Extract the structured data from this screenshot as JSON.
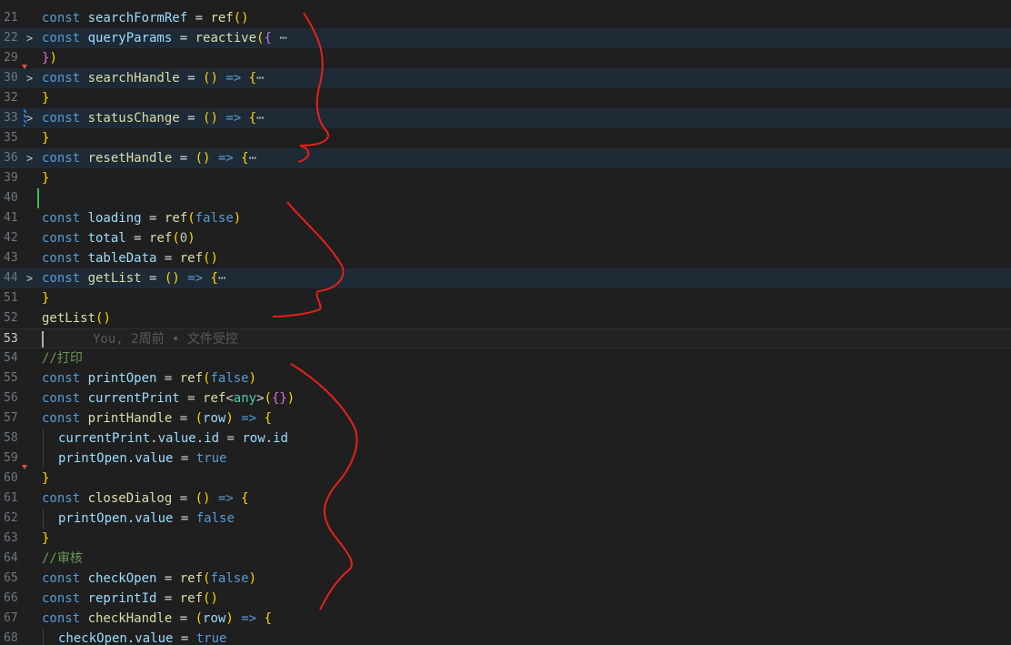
{
  "editor": {
    "blame_text": "You, 2周前 • 文件受控",
    "annotation_color": "#e8201a",
    "lines": [
      {
        "n": "21",
        "fold": "",
        "tokens": [
          [
            "kw",
            "const "
          ],
          [
            "var",
            "searchFormRef"
          ],
          [
            "op",
            " = "
          ],
          [
            "fn",
            "ref"
          ],
          [
            "b1",
            "()"
          ]
        ]
      },
      {
        "n": "22",
        "fold": ">",
        "folded": true,
        "tokens": [
          [
            "kw",
            "const "
          ],
          [
            "var",
            "queryParams"
          ],
          [
            "op",
            " = "
          ],
          [
            "fn",
            "reactive"
          ],
          [
            "b1",
            "("
          ],
          [
            "b2",
            "{"
          ],
          [
            "ell",
            " ⋯"
          ]
        ]
      },
      {
        "n": "29",
        "fold": "",
        "tokens": [
          [
            "b2",
            "}"
          ],
          [
            "b1",
            ")"
          ]
        ]
      },
      {
        "n": "30",
        "fold": ">",
        "folded": true,
        "tokens": [
          [
            "kw",
            "const "
          ],
          [
            "fn",
            "searchHandle"
          ],
          [
            "op",
            " = "
          ],
          [
            "b1",
            "()"
          ],
          [
            "kw",
            " => "
          ],
          [
            "b1",
            "{"
          ],
          [
            "ell",
            "⋯"
          ]
        ]
      },
      {
        "n": "32",
        "fold": "",
        "tokens": [
          [
            "b1",
            "}"
          ]
        ]
      },
      {
        "n": "33",
        "fold": ">",
        "folded": true,
        "tokens": [
          [
            "kw",
            "const "
          ],
          [
            "fn",
            "statusChange"
          ],
          [
            "op",
            " = "
          ],
          [
            "b1",
            "()"
          ],
          [
            "kw",
            " => "
          ],
          [
            "b1",
            "{"
          ],
          [
            "ell",
            "⋯"
          ]
        ]
      },
      {
        "n": "35",
        "fold": "",
        "tokens": [
          [
            "b1",
            "}"
          ]
        ]
      },
      {
        "n": "36",
        "fold": ">",
        "folded": true,
        "tokens": [
          [
            "kw",
            "const "
          ],
          [
            "fn",
            "resetHandle"
          ],
          [
            "op",
            " = "
          ],
          [
            "b1",
            "()"
          ],
          [
            "kw",
            " => "
          ],
          [
            "b1",
            "{"
          ],
          [
            "ell",
            "⋯"
          ]
        ]
      },
      {
        "n": "39",
        "fold": "",
        "tokens": [
          [
            "b1",
            "}"
          ]
        ]
      },
      {
        "n": "40",
        "fold": "",
        "tokens": []
      },
      {
        "n": "41",
        "fold": "",
        "tokens": [
          [
            "kw",
            "const "
          ],
          [
            "var",
            "loading"
          ],
          [
            "op",
            " = "
          ],
          [
            "fn",
            "ref"
          ],
          [
            "b1",
            "("
          ],
          [
            "kw",
            "false"
          ],
          [
            "b1",
            ")"
          ]
        ]
      },
      {
        "n": "42",
        "fold": "",
        "tokens": [
          [
            "kw",
            "const "
          ],
          [
            "var",
            "total"
          ],
          [
            "op",
            " = "
          ],
          [
            "fn",
            "ref"
          ],
          [
            "b1",
            "("
          ],
          [
            "num",
            "0"
          ],
          [
            "b1",
            ")"
          ]
        ]
      },
      {
        "n": "43",
        "fold": "",
        "tokens": [
          [
            "kw",
            "const "
          ],
          [
            "var",
            "tableData"
          ],
          [
            "op",
            " = "
          ],
          [
            "fn",
            "ref"
          ],
          [
            "b1",
            "()"
          ]
        ]
      },
      {
        "n": "44",
        "fold": ">",
        "folded": true,
        "tokens": [
          [
            "kw",
            "const "
          ],
          [
            "fn",
            "getList"
          ],
          [
            "op",
            " = "
          ],
          [
            "b1",
            "()"
          ],
          [
            "kw",
            " => "
          ],
          [
            "b1",
            "{"
          ],
          [
            "ell",
            "⋯"
          ]
        ]
      },
      {
        "n": "51",
        "fold": "",
        "tokens": [
          [
            "b1",
            "}"
          ]
        ]
      },
      {
        "n": "52",
        "fold": "",
        "tokens": [
          [
            "fn",
            "getList"
          ],
          [
            "b1",
            "()"
          ]
        ]
      },
      {
        "n": "53",
        "fold": "",
        "current": true,
        "tokens": []
      },
      {
        "n": "54",
        "fold": "",
        "tokens": [
          [
            "cmt",
            "//打印"
          ]
        ]
      },
      {
        "n": "55",
        "fold": "",
        "tokens": [
          [
            "kw",
            "const "
          ],
          [
            "var",
            "printOpen"
          ],
          [
            "op",
            " = "
          ],
          [
            "fn",
            "ref"
          ],
          [
            "b1",
            "("
          ],
          [
            "kw",
            "false"
          ],
          [
            "b1",
            ")"
          ]
        ]
      },
      {
        "n": "56",
        "fold": "",
        "tokens": [
          [
            "kw",
            "const "
          ],
          [
            "var",
            "currentPrint"
          ],
          [
            "op",
            " = "
          ],
          [
            "fn",
            "ref"
          ],
          [
            "op",
            "<"
          ],
          [
            "typ",
            "any"
          ],
          [
            "op",
            ">"
          ],
          [
            "b1",
            "("
          ],
          [
            "b2",
            "{}"
          ],
          [
            "b1",
            ")"
          ]
        ]
      },
      {
        "n": "57",
        "fold": "",
        "tokens": [
          [
            "kw",
            "const "
          ],
          [
            "fn",
            "printHandle"
          ],
          [
            "op",
            " = "
          ],
          [
            "b1",
            "("
          ],
          [
            "var",
            "row"
          ],
          [
            "b1",
            ")"
          ],
          [
            "kw",
            " => "
          ],
          [
            "b1",
            "{"
          ]
        ]
      },
      {
        "n": "58",
        "fold": "",
        "indent": true,
        "tokens": [
          [
            "var",
            "currentPrint"
          ],
          [
            "op",
            "."
          ],
          [
            "var",
            "value"
          ],
          [
            "op",
            "."
          ],
          [
            "var",
            "id"
          ],
          [
            "op",
            " = "
          ],
          [
            "var",
            "row"
          ],
          [
            "op",
            "."
          ],
          [
            "var",
            "id"
          ]
        ]
      },
      {
        "n": "59",
        "fold": "",
        "indent": true,
        "tokens": [
          [
            "var",
            "printOpen"
          ],
          [
            "op",
            "."
          ],
          [
            "var",
            "value"
          ],
          [
            "op",
            " = "
          ],
          [
            "kw",
            "true"
          ]
        ]
      },
      {
        "n": "60",
        "fold": "",
        "tokens": [
          [
            "b1",
            "}"
          ]
        ]
      },
      {
        "n": "61",
        "fold": "",
        "tokens": [
          [
            "kw",
            "const "
          ],
          [
            "fn",
            "closeDialog"
          ],
          [
            "op",
            " = "
          ],
          [
            "b1",
            "()"
          ],
          [
            "kw",
            " => "
          ],
          [
            "b1",
            "{"
          ]
        ]
      },
      {
        "n": "62",
        "fold": "",
        "indent": true,
        "tokens": [
          [
            "var",
            "printOpen"
          ],
          [
            "op",
            "."
          ],
          [
            "var",
            "value"
          ],
          [
            "op",
            " = "
          ],
          [
            "kw",
            "false"
          ]
        ]
      },
      {
        "n": "63",
        "fold": "",
        "tokens": [
          [
            "b1",
            "}"
          ]
        ]
      },
      {
        "n": "64",
        "fold": "",
        "tokens": [
          [
            "cmt",
            "//审核"
          ]
        ]
      },
      {
        "n": "65",
        "fold": "",
        "tokens": [
          [
            "kw",
            "const "
          ],
          [
            "var",
            "checkOpen"
          ],
          [
            "op",
            " = "
          ],
          [
            "fn",
            "ref"
          ],
          [
            "b1",
            "("
          ],
          [
            "kw",
            "false"
          ],
          [
            "b1",
            ")"
          ]
        ]
      },
      {
        "n": "66",
        "fold": "",
        "tokens": [
          [
            "kw",
            "const "
          ],
          [
            "var",
            "reprintId"
          ],
          [
            "op",
            " = "
          ],
          [
            "fn",
            "ref"
          ],
          [
            "b1",
            "()"
          ]
        ]
      },
      {
        "n": "67",
        "fold": "",
        "tokens": [
          [
            "kw",
            "const "
          ],
          [
            "fn",
            "checkHandle"
          ],
          [
            "op",
            " = "
          ],
          [
            "b1",
            "("
          ],
          [
            "var",
            "row"
          ],
          [
            "b1",
            ")"
          ],
          [
            "kw",
            " => "
          ],
          [
            "b1",
            "{"
          ]
        ]
      },
      {
        "n": "68",
        "fold": "",
        "indent": true,
        "tokens": [
          [
            "var",
            "checkOpen"
          ],
          [
            "op",
            "."
          ],
          [
            "var",
            "value"
          ],
          [
            "op",
            " = "
          ],
          [
            "kw",
            "true"
          ]
        ]
      }
    ]
  }
}
